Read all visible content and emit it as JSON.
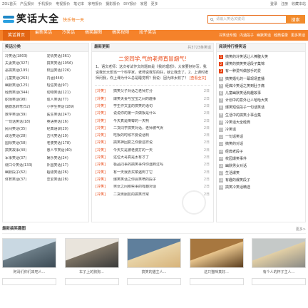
{
  "topbar": {
    "links": [
      "ZOL首页",
      "产品报价",
      "手机报价",
      "电视报价",
      "笔记本",
      "家电报价",
      "摄影报价",
      "DIY报价",
      "家居",
      "更多"
    ],
    "right": [
      "登录",
      "注册",
      "收藏本站"
    ]
  },
  "header": {
    "logo_text": "笑话大全",
    "slogan": "快乐每一天",
    "search_placeholder": "请输入笑话关键词",
    "search_button": "搜索"
  },
  "nav": {
    "items": [
      "笑话首页",
      "最新笑话",
      "冷笑话",
      "搞笑趣图",
      "搞笑视频",
      "段子笑话"
    ],
    "sub": [
      "冷笑话专题",
      "内涵段子",
      "幽默笑话",
      "经典语录",
      "更多笑话"
    ]
  },
  "categories": {
    "title": "笑话分类",
    "items": [
      "冷笑话(1803)",
      "爱情笑话(361)",
      "夫妻笑话(327)",
      "搞笑笑话(1056)",
      "恶搞笑话(195)",
      "校园笑话(226)",
      "儿童笑话(263)",
      "内涵(448)",
      "幽默笑话(125)",
      "短信笑话(97)",
      "经典笑话(344)",
      "动物笑话(121)",
      "职场笑话(98)",
      "成人笑话(77)",
      "脑筋急转弯(52)",
      "小学生笑话(189)",
      "数学笑话(39)",
      "医生笑话(247)",
      "一句话笑话(18)",
      "英语笑话(16)",
      "民间笑话(35)",
      "经典语录(20)",
      "政治笑话(28)",
      "古代笑话(19)",
      "国际笑话(58)",
      "老婆笑话(178)",
      "搞笑故事(40)",
      "愚人节笑话(40)",
      "军事笑话(37)",
      "娱乐笑话(24)",
      "绕口令笑话(133)",
      "外国笑话(17)",
      "幽默段子(62)",
      "超级笑话(26)",
      "体育笑话(37)",
      "恋爱笑话(28)"
    ]
  },
  "latest": {
    "title": "最新更新",
    "more": "共3723条笑话",
    "feature_title": "二货同学,气的老师直冒烟气!",
    "feature_body": "1、语文老师：这次考试作文的题目是《我的理想》，大家要好好写，我说我长大想当一个科学家，老师说我写的好，就让我念了。2、上课时老师问我，你上课为什么总是睡觉啊？我说：因为床太软了！",
    "feature_more": "[查看全文]",
    "rows": [
      {
        "tag": "[冷笑]",
        "title": "搞笑父子对话之老师打分",
        "date": "2日"
      },
      {
        "tag": "[冷笑]",
        "title": "爆笑夫妻与宝宝之间的趣事",
        "date": "2日"
      },
      {
        "tag": "[冷笑]",
        "title": "学生作文里的搞笑的语句",
        "date": "2日"
      },
      {
        "tag": "[冷笑]",
        "title": "说说你的第一次做饭是什么",
        "date": "2日"
      },
      {
        "tag": "[冷笑]",
        "title": "今天真是倒霉的一天啊",
        "date": "2日"
      },
      {
        "tag": "[冷笑]",
        "title": "二货同学搞笑对话，老师被气哭",
        "date": "2日"
      },
      {
        "tag": "[冷笑]",
        "title": "吃饭的时候不要说话啊",
        "date": "2日"
      },
      {
        "tag": "[冷笑]",
        "title": "搞笑神回复之你要这样说",
        "date": "2日"
      },
      {
        "tag": "[冷笑]",
        "title": "今天又是被老婆打的一天",
        "date": "2日"
      },
      {
        "tag": "[冷笑]",
        "title": "这位大哥真是太有才了",
        "date": "2日"
      },
      {
        "tag": "[冷笑]",
        "title": "极品同事的搞笑事件你遇到过吗",
        "date": "2日"
      },
      {
        "tag": "[冷笑]",
        "title": "有一天我去买菜遇到了它",
        "date": "2日"
      },
      {
        "tag": "[冷笑]",
        "title": "爆笑笑话之你会笑喷的段子",
        "date": "2日"
      },
      {
        "tag": "[冷笑]",
        "title": "男女之间那些事的有趣对话",
        "date": "2日"
      },
      {
        "tag": "[冷笑]",
        "title": "二货男朋友的搞笑日常",
        "date": "2日"
      }
    ]
  },
  "ranking": {
    "title": "阅读排行榜笑话",
    "items": [
      "搞笑的冷笑话让人捧腹大笑",
      "爆笑的搞笑笑话段子集锦",
      "有一种爱叫做放手的爱",
      "搞笑婚礼的一幕现场直播",
      "经典冷笑话之笑到肚子痛",
      "儿童幽默笑话有趣故事",
      "计划中的意外让人哈哈大笑",
      "爆笑短信段子一句话笑话",
      "生活中的搞笑小事合集",
      "冷笑话大全经典",
      "冷笑话",
      "一句话笑话",
      "搞笑的对话",
      "经典老段子",
      "校园爆笑事件",
      "幽默男女对话",
      "生活爆笑",
      "有趣的爆笑段子",
      "搞笑冷笑话精选"
    ]
  },
  "pictures": {
    "title": "最新搞笑趣图",
    "more": "更多>",
    "items": [
      {
        "caption": "阿哥们你们来吧人..."
      },
      {
        "caption": "车子上的狗狗..."
      },
      {
        "caption": "搞笑的猫主人..."
      },
      {
        "caption": "这只猫咪真好..."
      },
      {
        "caption": "有个人的杯子主人..."
      }
    ]
  },
  "colors": {
    "accent": "#f5822a",
    "red": "#e8430f",
    "logo_blue": "#1e88c7"
  }
}
